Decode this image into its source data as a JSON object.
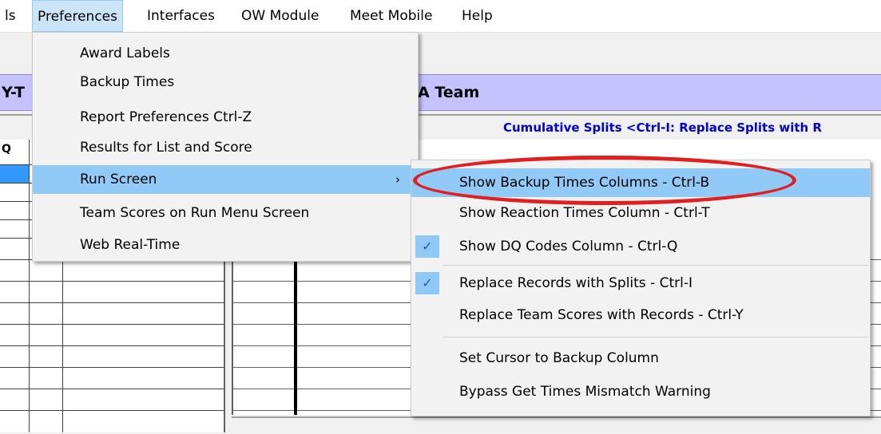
{
  "menubar": {
    "items": [
      {
        "label": "ls"
      },
      {
        "label": "Preferences"
      },
      {
        "label": "Interfaces"
      },
      {
        "label": "OW Module"
      },
      {
        "label": "Meet Mobile"
      },
      {
        "label": "Help"
      }
    ]
  },
  "background": {
    "band_left_text": "Y-T",
    "band_right_text": "A Team",
    "splits_text": "Cumulative Splits   <Ctrl-I: Replace Splits with R",
    "grid_header_q": "Q"
  },
  "preferences_menu": {
    "items": [
      {
        "label": "Award Labels"
      },
      {
        "label": "Backup Times"
      },
      {
        "label": "Report Preferences  Ctrl-Z"
      },
      {
        "label": "Results for List and Score"
      },
      {
        "label": "Run Screen",
        "submenu_arrow": "›"
      },
      {
        "label": "Team Scores on Run Menu Screen"
      },
      {
        "label": "Web Real-Time"
      }
    ]
  },
  "run_screen_submenu": {
    "items": [
      {
        "label": "Show Backup Times Columns - Ctrl-B",
        "checked": false
      },
      {
        "label": "Show Reaction Times Column - Ctrl-T",
        "checked": false
      },
      {
        "label": "Show DQ Codes Column - Ctrl-Q",
        "checked": true
      },
      {
        "label": "Replace Records with Splits - Ctrl-I",
        "checked": true
      },
      {
        "label": "Replace Team Scores with Records - Ctrl-Y",
        "checked": false
      },
      {
        "label": "Set Cursor to Backup Column",
        "checked": false
      },
      {
        "label": "Bypass Get Times Mismatch Warning",
        "checked": false
      }
    ],
    "check_glyph": "✓"
  },
  "colors": {
    "menu_highlight": "#91c9f7",
    "annotation": "#e02020",
    "band": "#c5c2ff"
  }
}
